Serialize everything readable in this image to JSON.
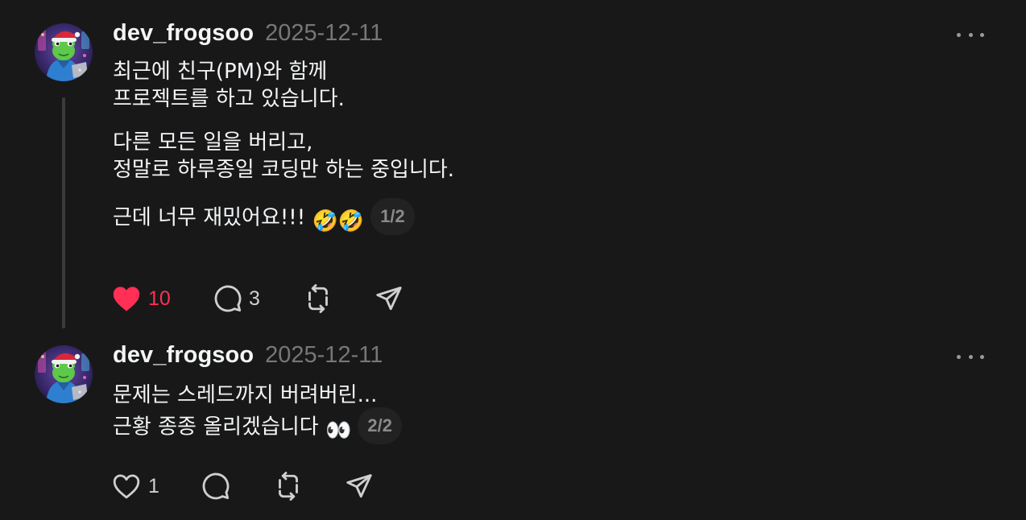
{
  "colors": {
    "background": "#181818",
    "text": "#f3f5f7",
    "muted": "#777777",
    "like_active": "#ff2f55",
    "thread_line": "#3b3b3b"
  },
  "posts": [
    {
      "username": "dev_frogsoo",
      "date": "2025-12-11",
      "lines": [
        "최근에 친구(PM)와 함께",
        "프로젝트를 하고 있습니다.",
        "다른 모든 일을 버리고,",
        "정말로 하루종일 코딩만 하는 중입니다.",
        "근데 너무 재밌어요!!!"
      ],
      "emoji": "🤣🤣",
      "pager": "1/2",
      "likes": "10",
      "liked": true,
      "replies": "3",
      "icons": {
        "like": "heart-filled-icon",
        "reply": "comment-bubble-icon",
        "repost": "repost-icon",
        "share": "send-paper-plane-icon",
        "more": "more-dots-icon"
      }
    },
    {
      "username": "dev_frogsoo",
      "date": "2025-12-11",
      "lines": [
        "문제는 스레드까지 버려버린...",
        "근황 종종 올리겠습니다"
      ],
      "emoji": "👀",
      "pager": "2/2",
      "likes": "1",
      "liked": false,
      "icons": {
        "like": "heart-outline-icon",
        "reply": "comment-bubble-icon",
        "repost": "repost-icon",
        "share": "send-paper-plane-icon",
        "more": "more-dots-icon"
      }
    }
  ]
}
